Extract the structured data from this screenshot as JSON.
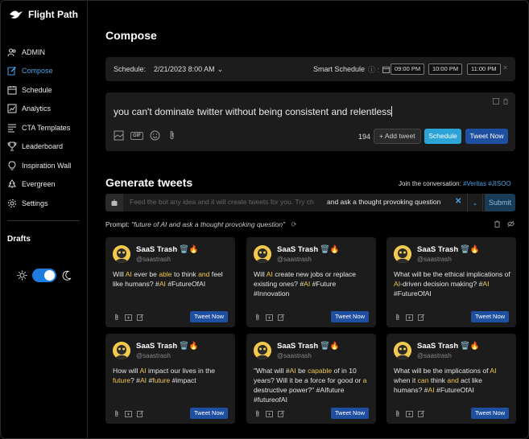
{
  "app": {
    "name": "Flight Path"
  },
  "sidebar": {
    "items": [
      {
        "label": "ADMIN",
        "icon": "users-icon"
      },
      {
        "label": "Compose",
        "icon": "compose-icon"
      },
      {
        "label": "Schedule",
        "icon": "calendar-icon"
      },
      {
        "label": "Analytics",
        "icon": "chart-icon"
      },
      {
        "label": "CTA Templates",
        "icon": "templates-icon"
      },
      {
        "label": "Leaderboard",
        "icon": "trophy-icon"
      },
      {
        "label": "Inspiration Wall",
        "icon": "bulb-icon"
      },
      {
        "label": "Evergreen",
        "icon": "tree-icon"
      },
      {
        "label": "Settings",
        "icon": "gear-icon"
      }
    ],
    "drafts_label": "Drafts",
    "theme": "dark"
  },
  "compose": {
    "title": "Compose",
    "schedule_label": "Schedule:",
    "date_value": "2/21/2023  8:00   AM",
    "smart_schedule_label": "Smart Schedule",
    "times": [
      "09:00 PM",
      "10:00 PM",
      "11:00 PM"
    ],
    "text": "you can't dominate twitter without being consistent and relentless",
    "char_count": "194",
    "add_tweet_label": "+ Add tweet",
    "schedule_button": "Schedule",
    "tweet_now_button": "Tweet Now",
    "gif_label": "GIF"
  },
  "generate": {
    "title": "Generate tweets",
    "join_label": "Join the conversation:",
    "tags": [
      "#Veritas",
      "#JISOO"
    ],
    "input_placeholder": "Feed the bot any idea and it will create tweets for you. Try ch",
    "input_value": "and ask a thought provoking question",
    "submit_label": "Submit",
    "prompt_label": "Prompt:",
    "prompt_value": "\"future of AI and ask a thought provoking question\""
  },
  "cards": [
    {
      "name": "SaaS Trash 🗑️🔥",
      "handle": "@saastrash",
      "tweet_now": "Tweet Now",
      "segments": [
        [
          "Will ",
          0
        ],
        [
          "AI",
          1
        ],
        [
          " ever be ",
          0
        ],
        [
          "able",
          1
        ],
        [
          " to think ",
          0
        ],
        [
          "and",
          1
        ],
        [
          " feel like humans? #",
          0
        ],
        [
          "AI",
          1
        ],
        [
          " #FutureOfAI",
          0
        ]
      ]
    },
    {
      "name": "SaaS Trash 🗑️🔥",
      "handle": "@saastrash",
      "tweet_now": "Tweet Now",
      "segments": [
        [
          "Will ",
          0
        ],
        [
          "AI",
          1
        ],
        [
          " create new jobs or replace existing ones? #",
          0
        ],
        [
          "AI",
          1
        ],
        [
          " #Future #Innovation",
          0
        ]
      ]
    },
    {
      "name": "SaaS Trash 🗑️🔥",
      "handle": "@saastrash",
      "tweet_now": "Tweet Now",
      "segments": [
        [
          "What will be the ethical implications of ",
          0
        ],
        [
          "AI",
          1
        ],
        [
          "-driven decision making? #",
          0
        ],
        [
          "AI",
          1
        ],
        [
          " #FutureOfAI",
          0
        ]
      ]
    },
    {
      "name": "SaaS Trash 🗑️🔥",
      "handle": "@saastrash",
      "tweet_now": "Tweet Now",
      "segments": [
        [
          "How will ",
          0
        ],
        [
          "AI",
          1
        ],
        [
          " impact our lives in the ",
          0
        ],
        [
          "future",
          1
        ],
        [
          "? #",
          0
        ],
        [
          "AI",
          1
        ],
        [
          " #",
          0
        ],
        [
          "future",
          1
        ],
        [
          " #impact",
          0
        ]
      ]
    },
    {
      "name": "SaaS Trash 🗑️🔥",
      "handle": "@saastrash",
      "tweet_now": "Tweet Now",
      "segments": [
        [
          "\"What will #",
          0
        ],
        [
          "AI",
          1
        ],
        [
          " be ",
          0
        ],
        [
          "capable",
          1
        ],
        [
          " of in 10 years? Will it be a force for good or ",
          0
        ],
        [
          "a",
          1
        ],
        [
          " destructive power?\" #AIfuture #futureofAI",
          0
        ]
      ]
    },
    {
      "name": "SaaS Trash 🗑️🔥",
      "handle": "@saastrash",
      "tweet_now": "Tweet Now",
      "segments": [
        [
          "What will be the implications of ",
          0
        ],
        [
          "AI",
          1
        ],
        [
          " when it ",
          0
        ],
        [
          "can",
          1
        ],
        [
          " think ",
          0
        ],
        [
          "and",
          1
        ],
        [
          " act like humans? #",
          0
        ],
        [
          "AI",
          1
        ],
        [
          " #FutureOfAI",
          0
        ]
      ]
    }
  ],
  "colors": {
    "accent": "#4aa3e8",
    "highlight": "#f2c94c",
    "tweet_button": "#1f4fa0",
    "schedule_button": "#2ca4d8",
    "card_bg": "#1c1c1c"
  }
}
